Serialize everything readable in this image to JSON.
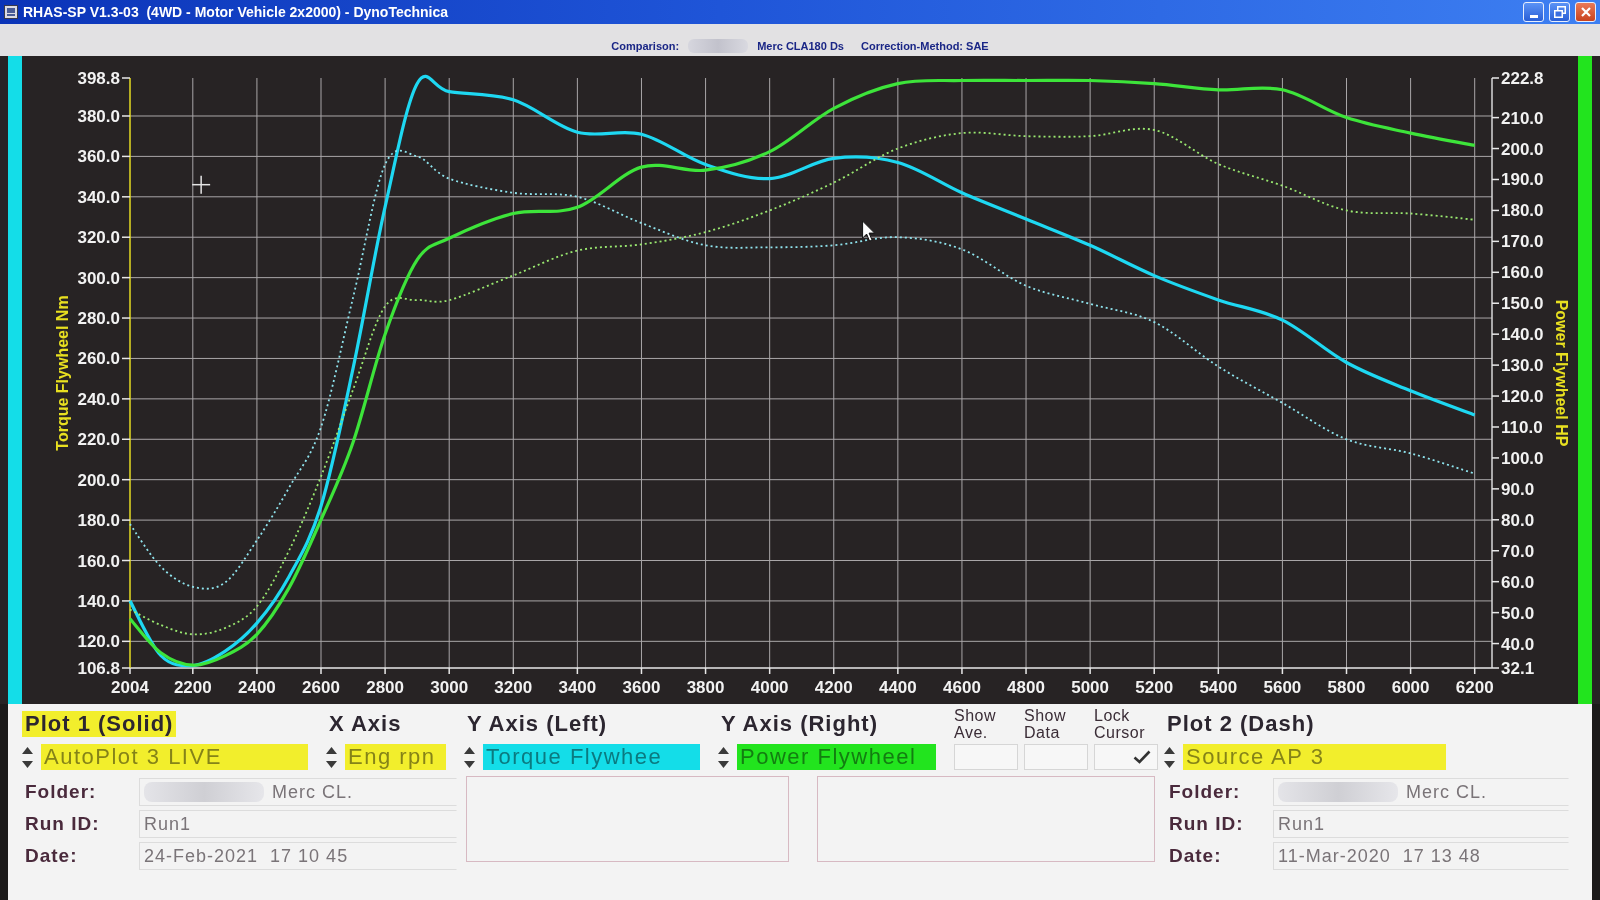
{
  "window": {
    "title": "RHAS-SP V1.3-03  (4WD - Motor Vehicle 2x2000) - DynoTechnica"
  },
  "comparison_bar": {
    "label": "Comparison:",
    "redacted": true,
    "vehicle": "Merc CLA180 Ds",
    "correction": "Correction-Method: SAE"
  },
  "chart": {
    "chart_data": {
      "type": "line",
      "grid": true,
      "ylabel": "Torque Flywheel Nm",
      "y2label": "Power Flywheel HP",
      "x": [
        2004,
        2100,
        2200,
        2300,
        2400,
        2500,
        2600,
        2700,
        2800,
        2900,
        3000,
        3200,
        3400,
        3600,
        3800,
        4000,
        4200,
        4400,
        4600,
        4800,
        5000,
        5200,
        5400,
        5600,
        5800,
        6000,
        6200
      ],
      "xlim": [
        2004,
        6254
      ],
      "ylim": [
        106.8,
        398.8
      ],
      "y2lim": [
        32.1,
        222.8
      ],
      "xticks": [
        2004,
        2200,
        2400,
        2600,
        2800,
        3000,
        3200,
        3400,
        3600,
        3800,
        4000,
        4200,
        4400,
        4600,
        4800,
        5000,
        5200,
        5400,
        5600,
        5800,
        6000,
        6200
      ],
      "yticks": [
        {
          "value": 106.8,
          "label": "106.8"
        },
        {
          "value": 120,
          "label": "120.0"
        },
        {
          "value": 140,
          "label": "140.0"
        },
        {
          "value": 160,
          "label": "160.0"
        },
        {
          "value": 180,
          "label": "180.0"
        },
        {
          "value": 200,
          "label": "200.0"
        },
        {
          "value": 220,
          "label": "220.0"
        },
        {
          "value": 240,
          "label": "240.0"
        },
        {
          "value": 260,
          "label": "260.0"
        },
        {
          "value": 280,
          "label": "280.0"
        },
        {
          "value": 300,
          "label": "300.0"
        },
        {
          "value": 320,
          "label": "320.0"
        },
        {
          "value": 340,
          "label": "340.0"
        },
        {
          "value": 360,
          "label": "360.0"
        },
        {
          "value": 380,
          "label": "380.0"
        },
        {
          "value": 398.8,
          "label": "398.8"
        }
      ],
      "y2ticks": [
        {
          "value": 32.1,
          "label": "32.1"
        },
        {
          "value": 40,
          "label": "40.0"
        },
        {
          "value": 50,
          "label": "50.0"
        },
        {
          "value": 60,
          "label": "60.0"
        },
        {
          "value": 70,
          "label": "70.0"
        },
        {
          "value": 80,
          "label": "80.0"
        },
        {
          "value": 90,
          "label": "90.0"
        },
        {
          "value": 100,
          "label": "100.0"
        },
        {
          "value": 110,
          "label": "110.0"
        },
        {
          "value": 120,
          "label": "120.0"
        },
        {
          "value": 130,
          "label": "130.0"
        },
        {
          "value": 140,
          "label": "140.0"
        },
        {
          "value": 150,
          "label": "150.0"
        },
        {
          "value": 160,
          "label": "160.0"
        },
        {
          "value": 170,
          "label": "170.0"
        },
        {
          "value": 180,
          "label": "180.0"
        },
        {
          "value": 190,
          "label": "190.0"
        },
        {
          "value": 200,
          "label": "200.0"
        },
        {
          "value": 210,
          "label": "210.0"
        },
        {
          "value": 222.8,
          "label": "222.8"
        }
      ],
      "series": [
        {
          "color": "#1ed8f2",
          "line_style": "solid",
          "values": [
            140,
            113,
            108,
            115,
            129,
            152,
            187,
            255,
            335,
            396,
            392,
            388,
            372,
            371,
            356,
            349,
            359,
            357,
            342,
            329,
            316,
            301,
            289,
            279,
            258,
            244,
            232
          ]
        },
        {
          "color": "#8fe4ee",
          "line_style": "dashed",
          "values": [
            178,
            157,
            147,
            149,
            170,
            196,
            226,
            290,
            356,
            360,
            349,
            342,
            340,
            327,
            316,
            315,
            316,
            320,
            314,
            296,
            287,
            278,
            256,
            238,
            220,
            213,
            203
          ]
        },
        {
          "color": "#3de43a",
          "axis": "y2",
          "line_style": "solid",
          "values": [
            48,
            37,
            33,
            36,
            43,
            58,
            80,
            105,
            140,
            164,
            171,
            179,
            181,
            194,
            193,
            199,
            213,
            221,
            222,
            222,
            222,
            221,
            219,
            219,
            210,
            205,
            201
          ]
        },
        {
          "color": "#9ae870",
          "axis": "y2",
          "line_style": "dashed",
          "values": [
            51,
            46,
            43,
            45,
            52,
            70,
            94,
            122,
            149,
            151,
            151,
            159,
            167,
            169,
            173,
            180,
            189,
            200,
            205,
            204,
            204,
            206,
            195,
            188,
            180,
            179,
            177
          ]
        }
      ]
    }
  },
  "controls": {
    "columns": [
      {
        "kind": "selector",
        "title": "Plot 1 (Solid)",
        "highlighted": true,
        "value": "AutoPlot 3 LIVE",
        "color": "#f2ee2c"
      },
      {
        "kind": "selector",
        "title": "X Axis",
        "highlighted": false,
        "value": "Eng rpn",
        "color": "#f2ee2c"
      },
      {
        "kind": "selector",
        "title": "Y Axis (Left)",
        "highlighted": false,
        "value": "Torque Flywhee",
        "color": "#14dde8"
      },
      {
        "kind": "selector",
        "title": "Y Axis (Right)",
        "highlighted": false,
        "value": "Power Flywheel",
        "color": "#22e41e"
      },
      {
        "kind": "checkbox",
        "title": "Show Ave.",
        "checked": false
      },
      {
        "kind": "checkbox",
        "title": "Show Data",
        "checked": false
      },
      {
        "kind": "checkbox",
        "title": "Lock Cursor",
        "checked": true
      },
      {
        "kind": "selector",
        "title": "Plot 2 (Dash)",
        "highlighted": false,
        "value": "Source AP 3",
        "color": "#f2ee2c"
      }
    ]
  },
  "run_info": [
    {
      "fields": [
        {
          "label": "Folder:",
          "value": "Merc CL.",
          "redacted": true
        },
        {
          "label": "Run ID:",
          "value": "Run1",
          "redacted": false
        },
        {
          "label": "Date:",
          "value": "24-Feb-2021  17 10 45",
          "redacted": false
        }
      ]
    },
    {
      "fields": [
        {
          "label": "Folder:",
          "value": "Merc CL.",
          "redacted": true
        },
        {
          "label": "Run ID:",
          "value": "Run1",
          "redacted": false
        },
        {
          "label": "Date:",
          "value": "11-Mar-2020  17 13 48",
          "redacted": false
        }
      ]
    }
  ]
}
